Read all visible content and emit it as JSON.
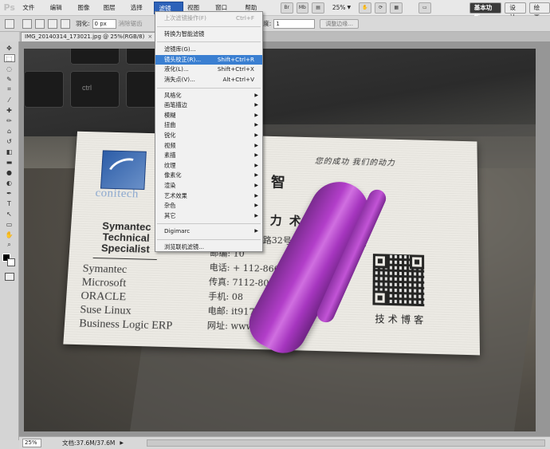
{
  "app": {
    "logo": "Ps",
    "menu": [
      "文件(F)",
      "编辑(E)",
      "图像(I)",
      "图层(L)",
      "选择(S)",
      "滤镜(T)",
      "视图(V)",
      "窗口(W)",
      "帮助(H)"
    ],
    "active_menu_index": 5,
    "zoom_level": "25%",
    "workspaces": [
      "基本功能",
      "设计",
      "绘画"
    ],
    "active_workspace": "基本功能"
  },
  "options_bar": {
    "feather_label": "羽化:",
    "feather_value": "0 px",
    "antialias_label": "消除锯齿",
    "height_label": "高度:",
    "height_value": "1",
    "refine_edge_label": "调整边缘..."
  },
  "document": {
    "tab_title": "IMG_20140314_173021.jpg @ 25%(RGB/8)",
    "close_glyph": "×"
  },
  "filter_menu": {
    "items": [
      {
        "label": "上次滤镜操作(F)",
        "shortcut": "Ctrl+F",
        "disabled": true
      },
      {
        "sep": true
      },
      {
        "label": "转换为智能滤镜"
      },
      {
        "sep": true
      },
      {
        "label": "滤镜库(G)..."
      },
      {
        "label": "镜头校正(R)...",
        "shortcut": "Shift+Ctrl+R",
        "highlight": true
      },
      {
        "label": "液化(L)...",
        "shortcut": "Shift+Ctrl+X"
      },
      {
        "label": "消失点(V)...",
        "shortcut": "Alt+Ctrl+V"
      },
      {
        "sep": true
      },
      {
        "label": "风格化",
        "submenu": true
      },
      {
        "label": "画笔描边",
        "submenu": true
      },
      {
        "label": "模糊",
        "submenu": true
      },
      {
        "label": "扭曲",
        "submenu": true
      },
      {
        "label": "锐化",
        "submenu": true
      },
      {
        "label": "视频",
        "submenu": true
      },
      {
        "label": "素描",
        "submenu": true
      },
      {
        "label": "纹理",
        "submenu": true
      },
      {
        "label": "像素化",
        "submenu": true
      },
      {
        "label": "渲染",
        "submenu": true
      },
      {
        "label": "艺术效果",
        "submenu": true
      },
      {
        "label": "杂色",
        "submenu": true
      },
      {
        "label": "其它",
        "submenu": true
      },
      {
        "sep": true
      },
      {
        "label": "Digimarc",
        "submenu": true
      },
      {
        "sep": true
      },
      {
        "label": "浏览联机滤镜..."
      }
    ]
  },
  "photo": {
    "keyboard_label": "ctrl",
    "card": {
      "logo_text": "conitech",
      "symantec_lines": [
        "Symantec",
        "Technical",
        "Specialist"
      ],
      "certs": [
        "Symantec",
        "Microsoft",
        "ORACLE",
        "Suse Linux",
        "Business Logic ERP"
      ],
      "slogan": "您的成功  我们的动力",
      "name_partial": "智",
      "company_partial": "力  术有限公司",
      "contact": [
        "地址: 北京          海路32号楼恒润国际1510室",
        "邮编: 10",
        "电话: +      112-866",
        "传真:         7112-800",
        "手机:         08",
        "电邮:      it9173.com",
        "网址: www.it9173.com"
      ],
      "qr_caption": "技术博客"
    }
  },
  "status": {
    "zoom": "25%",
    "doc_size": "文档:37.6M/37.6M",
    "arrow": "▶"
  },
  "tools": [
    "move-tool",
    "marquee-tool",
    "lasso-tool",
    "quick-select-tool",
    "crop-tool",
    "eyedropper-tool",
    "healing-tool",
    "brush-tool",
    "clone-stamp-tool",
    "history-brush-tool",
    "eraser-tool",
    "gradient-tool",
    "blur-tool",
    "dodge-tool",
    "pen-tool",
    "type-tool",
    "path-select-tool",
    "shape-tool",
    "hand-tool",
    "zoom-tool"
  ]
}
